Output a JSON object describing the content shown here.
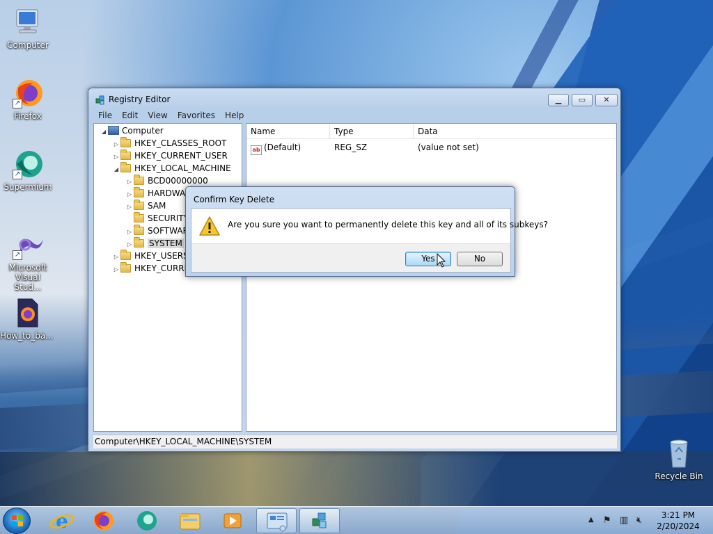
{
  "desktop": {
    "icons": [
      {
        "label": "Computer"
      },
      {
        "label": "Firefox"
      },
      {
        "label": "Supermium"
      },
      {
        "label": "Microsoft Visual Stud..."
      },
      {
        "label": "How_to_ba..."
      },
      {
        "label": "Recycle Bin"
      }
    ]
  },
  "window": {
    "title": "Registry Editor",
    "menu": [
      "File",
      "Edit",
      "View",
      "Favorites",
      "Help"
    ],
    "tree": [
      {
        "label": "Computer",
        "toggle": "◢"
      },
      {
        "label": "HKEY_CLASSES_ROOT",
        "toggle": "▷"
      },
      {
        "label": "HKEY_CURRENT_USER",
        "toggle": "▷"
      },
      {
        "label": "HKEY_LOCAL_MACHINE",
        "toggle": "◢"
      },
      {
        "label": "BCD00000000",
        "toggle": "▷"
      },
      {
        "label": "HARDWARE",
        "toggle": "▷"
      },
      {
        "label": "SAM",
        "toggle": "▷"
      },
      {
        "label": "SECURITY",
        "toggle": ""
      },
      {
        "label": "SOFTWARE",
        "toggle": "▷"
      },
      {
        "label": "SYSTEM",
        "toggle": "▷"
      },
      {
        "label": "HKEY_USERS",
        "toggle": "▷"
      },
      {
        "label": "HKEY_CURRENT_CONFIG",
        "toggle": "▷"
      }
    ],
    "columns": {
      "name": "Name",
      "type": "Type",
      "data": "Data"
    },
    "values": [
      {
        "name": "(Default)",
        "type": "REG_SZ",
        "data": "(value not set)"
      }
    ],
    "status": "Computer\\HKEY_LOCAL_MACHINE\\SYSTEM"
  },
  "dialog": {
    "title": "Confirm Key Delete",
    "message": "Are you sure you want to permanently delete this key and all of its subkeys?",
    "yes_label": "Yes",
    "no_label": "No"
  },
  "taskbar": {
    "time": "3:21 PM",
    "date": "2/20/2024"
  }
}
